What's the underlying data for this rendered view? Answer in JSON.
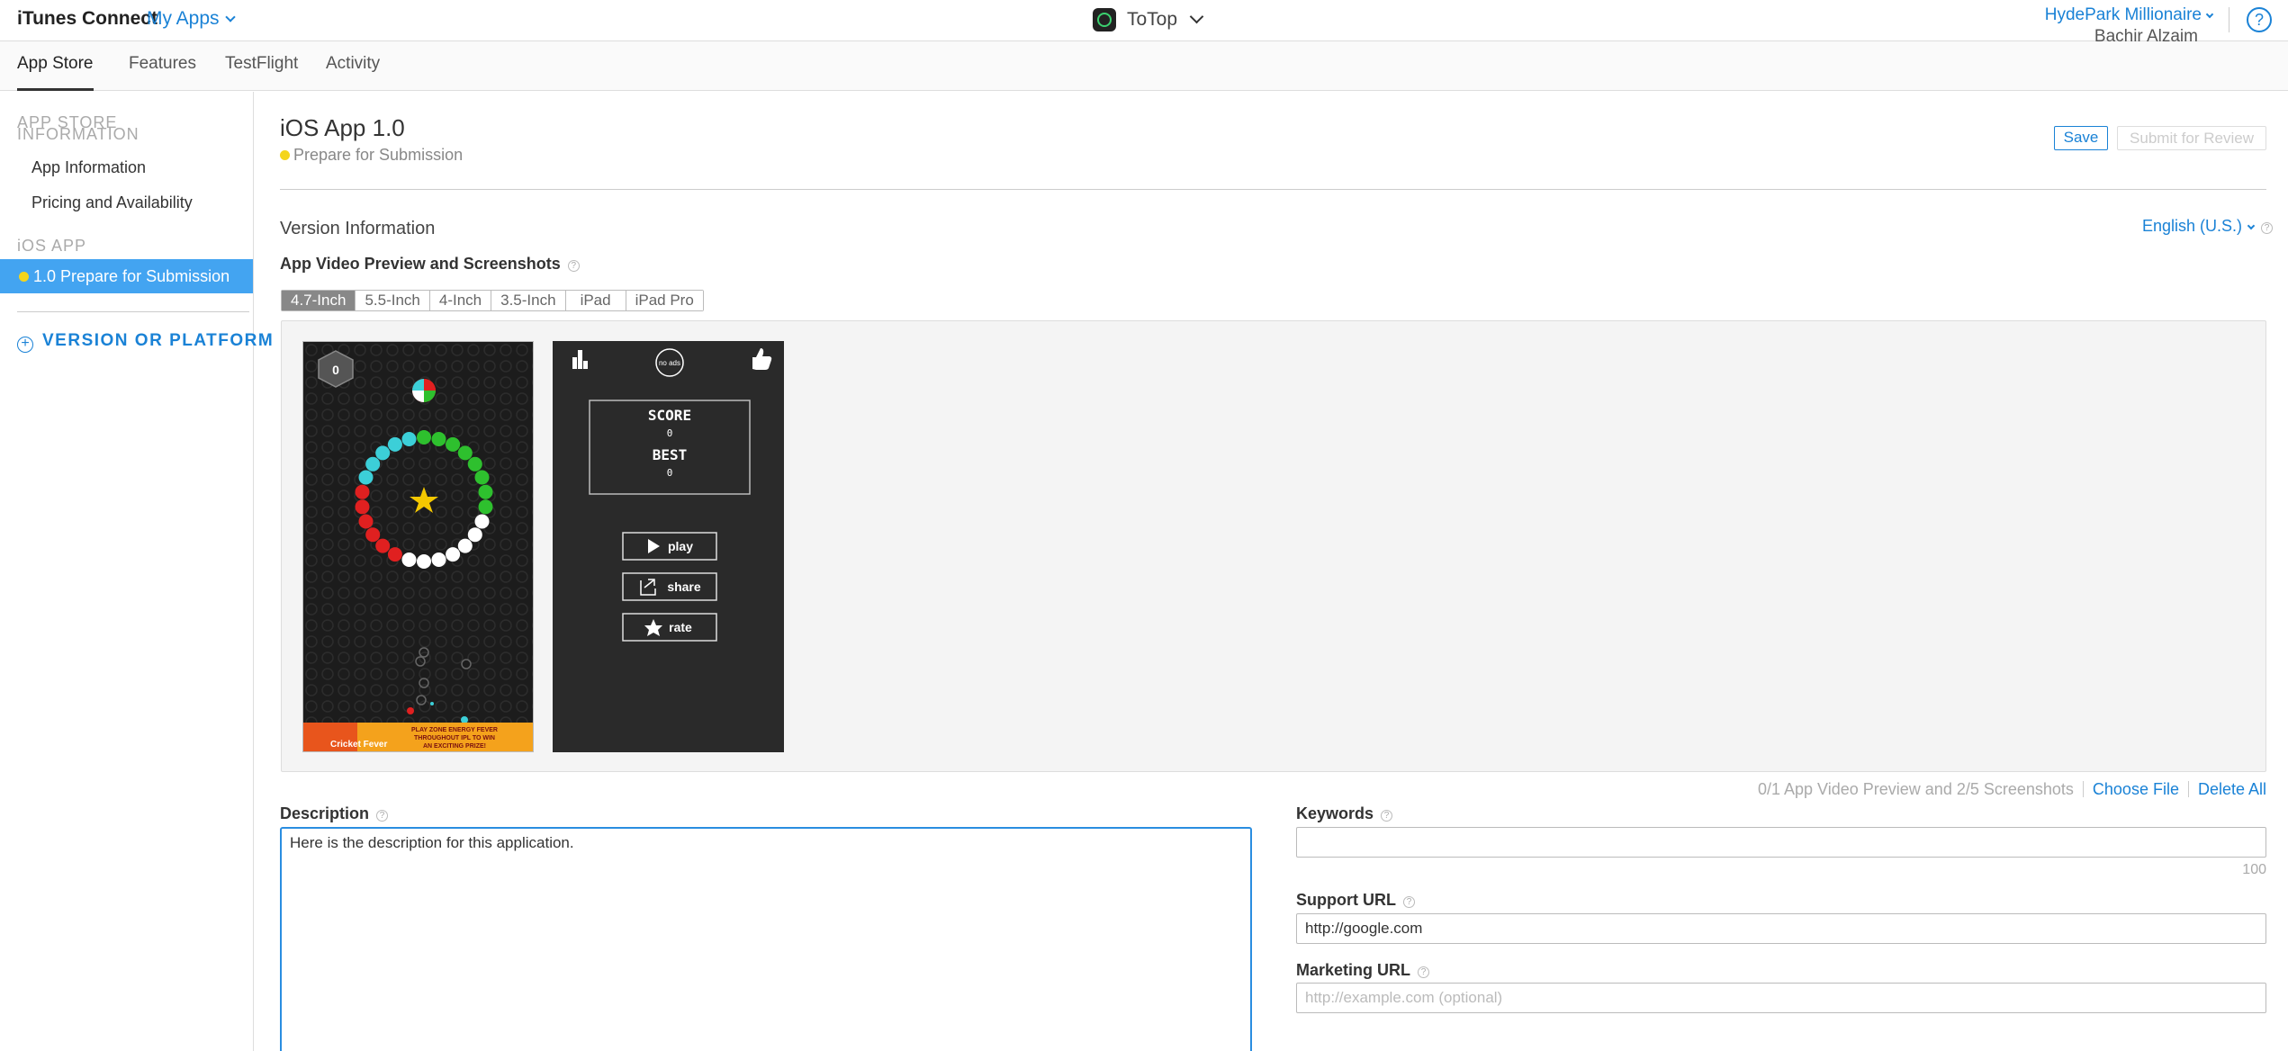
{
  "topbar": {
    "brand": "iTunes Connect",
    "my_apps": "My Apps",
    "app_name": "ToTop",
    "account_name": "HydePark Millionaire",
    "user_name": "Bachir Alzaim",
    "help": "?"
  },
  "tabs": [
    {
      "label": "App Store",
      "active": true
    },
    {
      "label": "Features"
    },
    {
      "label": "TestFlight"
    },
    {
      "label": "Activity"
    }
  ],
  "sidebar": {
    "section_store_line1": "APP STORE",
    "section_store_line2": "INFORMATION",
    "items": [
      "App Information",
      "Pricing and Availability"
    ],
    "section_ios": "iOS APP",
    "selected_item": "1.0 Prepare for Submission",
    "add_label": "VERSION OR PLATFORM",
    "add_icon": "+"
  },
  "main": {
    "title": "iOS App 1.0",
    "status": "Prepare for Submission",
    "save_label": "Save",
    "submit_label": "Submit for Review",
    "section_title": "Version Information",
    "language": "English (U.S.)",
    "media_title": "App Video Preview and Screenshots",
    "device_tabs": [
      "4.7-Inch",
      "5.5-Inch",
      "4-Inch",
      "3.5-Inch",
      "iPad",
      "iPad Pro"
    ],
    "media_count": "0/1 App Video Preview and 2/5 Screenshots",
    "choose_file": "Choose File",
    "delete_all": "Delete All",
    "description_label": "Description",
    "description_value": "Here is the description for this application.",
    "keywords_label": "Keywords",
    "keywords_value": "",
    "keywords_remaining": "100",
    "support_label": "Support URL",
    "support_value": "http://google.com",
    "marketing_label": "Marketing URL",
    "marketing_placeholder": "http://example.com (optional)",
    "help_mark": "?"
  },
  "screenshot1": {
    "score": "0",
    "ad_line1": "PLAY ZONE ENERGY FEVER",
    "ad_line2": "THROUGHOUT IPL TO WIN",
    "ad_line3": "AN EXCITING PRIZE!",
    "ad_brand": "Cricket Fever"
  },
  "screenshot2": {
    "no_ads": "no ads",
    "score_label": "SCORE",
    "score_value": "0",
    "best_label": "BEST",
    "best_value": "0",
    "play": "play",
    "share": "share",
    "rate": "rate"
  },
  "colors": {
    "accent": "#1a82d6",
    "selected_bg": "#43a4f1",
    "status_dot": "#f4d51c"
  }
}
